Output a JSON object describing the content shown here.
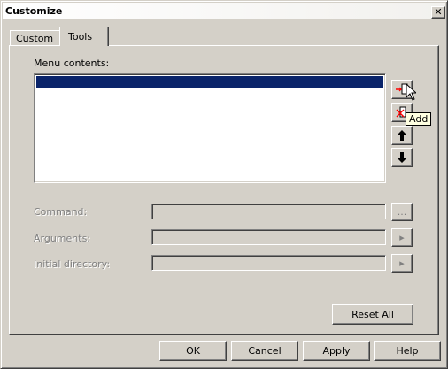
{
  "window": {
    "title": "Customize",
    "close_glyph": "✕"
  },
  "tabs": [
    {
      "label": "Custom",
      "active": false
    },
    {
      "label": "Tools",
      "active": true
    }
  ],
  "tools_panel": {
    "menu_contents_label": "Menu contents:",
    "menu_items": [
      ""
    ],
    "selected_index": 0,
    "side_buttons": {
      "add_icon": "add-tool-icon",
      "delete_icon": "delete-tool-icon",
      "move_up_icon": "arrow-up-icon",
      "move_down_icon": "arrow-down-icon"
    },
    "tooltip": "Add",
    "command_label": "Command:",
    "command_value": "",
    "command_browse_label": "...",
    "arguments_label": "Arguments:",
    "arguments_value": "",
    "arguments_menu_glyph": "▸",
    "initial_directory_label": "Initial directory:",
    "initial_directory_value": "",
    "initial_directory_menu_glyph": "▸",
    "reset_all_label": "Reset All"
  },
  "footer_buttons": {
    "ok": "OK",
    "cancel": "Cancel",
    "apply": "Apply",
    "help": "Help"
  },
  "colors": {
    "face": "#d4d0c8",
    "selection": "#0a246a",
    "tooltip_bg": "#ffffe1",
    "disabled_text": "#808080"
  }
}
